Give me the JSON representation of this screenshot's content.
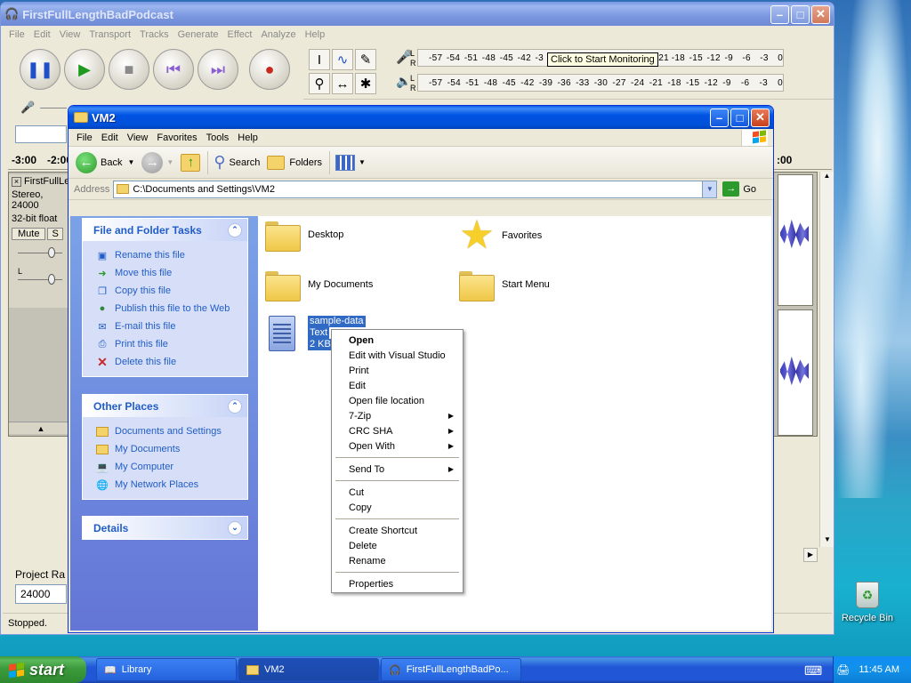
{
  "audacity": {
    "title": "FirstFullLengthBadPodcast",
    "menu": [
      "File",
      "Edit",
      "View",
      "Transport",
      "Tracks",
      "Generate",
      "Effect",
      "Analyze",
      "Help"
    ],
    "meter_ticks": [
      "-57",
      "-54",
      "-51",
      "-48",
      "-45",
      "-42",
      "-39",
      "-36",
      "-33",
      "-30",
      "-27",
      "-24",
      "-21",
      "-18",
      "-15",
      "-12",
      "-9",
      "-6",
      "-3",
      "0"
    ],
    "meter_top_prefix": [
      "-57",
      "-54",
      "-51",
      "-48",
      "-45",
      "-42",
      "-3"
    ],
    "meter_top_suffix": [
      "21",
      "-18",
      "-15",
      "-12",
      "-9",
      "-6",
      "-3",
      "0"
    ],
    "meter_tooltip": "Click to Start Monitoring",
    "timeline": [
      "-3:00",
      "-2:00"
    ],
    "timeline_right": ":00",
    "track": {
      "name": "FirstFullLe",
      "info1": "Stereo, 24000",
      "info2": "32-bit float",
      "mute": "Mute",
      "solo": "S"
    },
    "project_rate_label": "Project Ra",
    "project_rate_value": "24000",
    "status": "Stopped."
  },
  "explorer": {
    "title": "VM2",
    "menu": [
      "File",
      "Edit",
      "View",
      "Favorites",
      "Tools",
      "Help"
    ],
    "toolbar": {
      "back": "Back",
      "search": "Search",
      "folders": "Folders"
    },
    "address_label": "Address",
    "address_value": "C:\\Documents and Settings\\VM2",
    "go": "Go",
    "file_tasks": {
      "title": "File and Folder Tasks",
      "items": [
        "Rename this file",
        "Move this file",
        "Copy this file",
        "Publish this file to the Web",
        "E-mail this file",
        "Print this file",
        "Delete this file"
      ]
    },
    "other_places": {
      "title": "Other Places",
      "items": [
        "Documents and Settings",
        "My Documents",
        "My Computer",
        "My Network Places"
      ]
    },
    "details": {
      "title": "Details"
    },
    "items": [
      {
        "name": "Desktop"
      },
      {
        "name": "Favorites"
      },
      {
        "name": "My Documents"
      },
      {
        "name": "Start Menu"
      }
    ],
    "selected_file": {
      "name": "sample-data",
      "type": "Text",
      "size": "2 KB"
    }
  },
  "context_menu": {
    "groups": [
      [
        "Open",
        "Edit with Visual Studio",
        "Print",
        "Edit",
        "Open file location",
        "7-Zip",
        "CRC SHA",
        "Open With"
      ],
      [
        "Send To"
      ],
      [
        "Cut",
        "Copy"
      ],
      [
        "Create Shortcut",
        "Delete",
        "Rename"
      ],
      [
        "Properties"
      ]
    ],
    "open": "Open",
    "submenu_items": [
      "7-Zip",
      "CRC SHA",
      "Open With",
      "Send To"
    ]
  },
  "desktop": {
    "recycle_bin": "Recycle Bin"
  },
  "taskbar": {
    "start": "start",
    "tasks": [
      "Library",
      "VM2",
      "FirstFullLengthBadPo..."
    ],
    "clock": "11:45 AM"
  }
}
